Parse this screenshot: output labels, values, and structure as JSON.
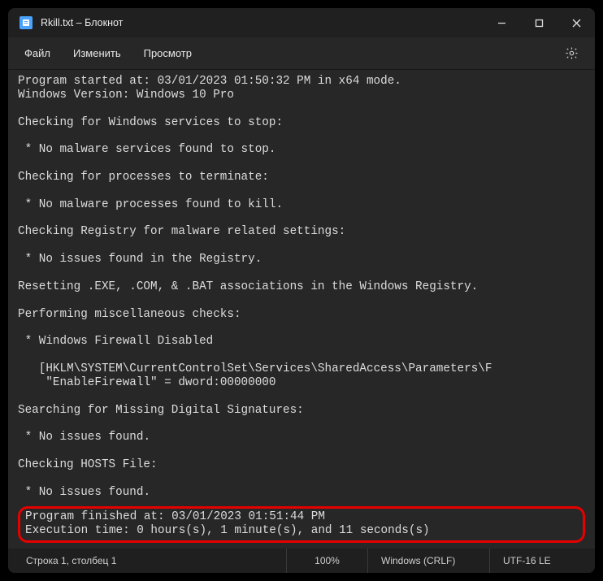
{
  "titlebar": {
    "title": "Rkill.txt – Блокнот"
  },
  "menu": {
    "file": "Файл",
    "edit": "Изменить",
    "view": "Просмотр"
  },
  "body": {
    "line1": "Program started at: 03/01/2023 01:50:32 PM in x64 mode.",
    "line2": "Windows Version: Windows 10 Pro",
    "line3": "Checking for Windows services to stop:",
    "line4": " * No malware services found to stop.",
    "line5": "Checking for processes to terminate:",
    "line6": " * No malware processes found to kill.",
    "line7": "Checking Registry for malware related settings:",
    "line8": " * No issues found in the Registry.",
    "line9": "Resetting .EXE, .COM, & .BAT associations in the Windows Registry.",
    "line10": "Performing miscellaneous checks:",
    "line11": " * Windows Firewall Disabled",
    "line12a": "   [HKLM\\SYSTEM\\CurrentControlSet\\Services\\SharedAccess\\Parameters\\F",
    "line12b": "    \"EnableFirewall\" = dword:00000000",
    "line13": "Searching for Missing Digital Signatures:",
    "line14": " * No issues found.",
    "line15": "Checking HOSTS File:",
    "line16": " * No issues found.",
    "line17": "Program finished at: 03/01/2023 01:51:44 PM",
    "line18": "Execution time: 0 hours(s), 1 minute(s), and 11 seconds(s)"
  },
  "status": {
    "cursor": "Строка 1, столбец 1",
    "zoom": "100%",
    "eol": "Windows (CRLF)",
    "encoding": "UTF-16 LE"
  }
}
